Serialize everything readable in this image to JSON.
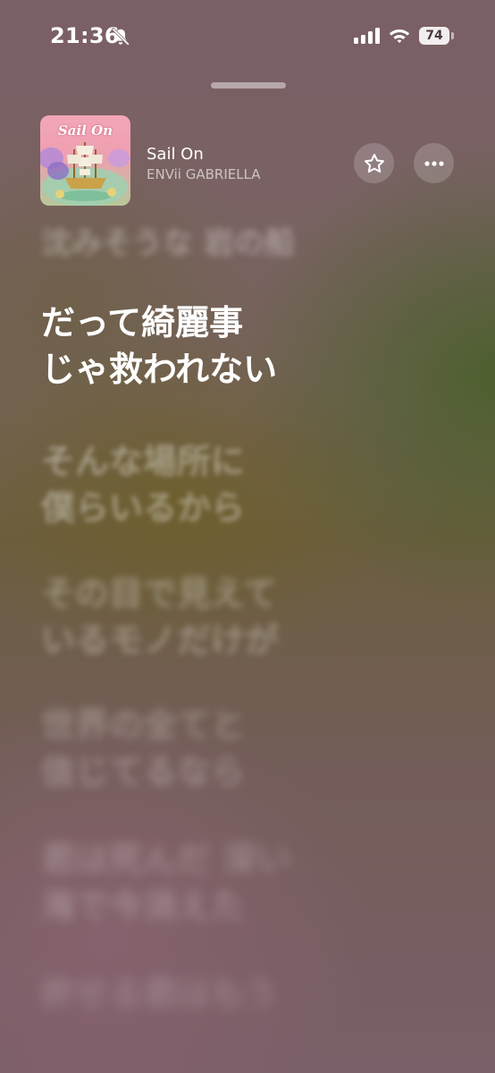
{
  "status_bar": {
    "time": "21:36",
    "battery": "74",
    "icons": [
      "bell-slash-icon",
      "cellular-signal-icon",
      "wifi-icon",
      "battery-icon"
    ]
  },
  "now_playing": {
    "artwork_text": "Sail On",
    "title": "Sail On",
    "artist": "ENVii GABRIELLA",
    "buttons": [
      "star-icon",
      "more-icon"
    ]
  },
  "lyrics": {
    "previous": [
      "沈みそうな 岩の船"
    ],
    "current": [
      "だって綺麗事",
      "じゃ救われない"
    ],
    "upcoming": [
      [
        "そんな場所に",
        "僕らいるから"
      ],
      [
        "その目で見えて",
        "いるモノだけが"
      ],
      [
        "世界の全てと",
        "信じてるなら"
      ],
      [
        "君は死んだ 深い",
        "海で今消えた"
      ],
      [
        "許せる君はもう"
      ]
    ]
  },
  "colors": {
    "accent_text": "#ffffff",
    "dim_text": "rgba(255,255,255,0.35)"
  }
}
